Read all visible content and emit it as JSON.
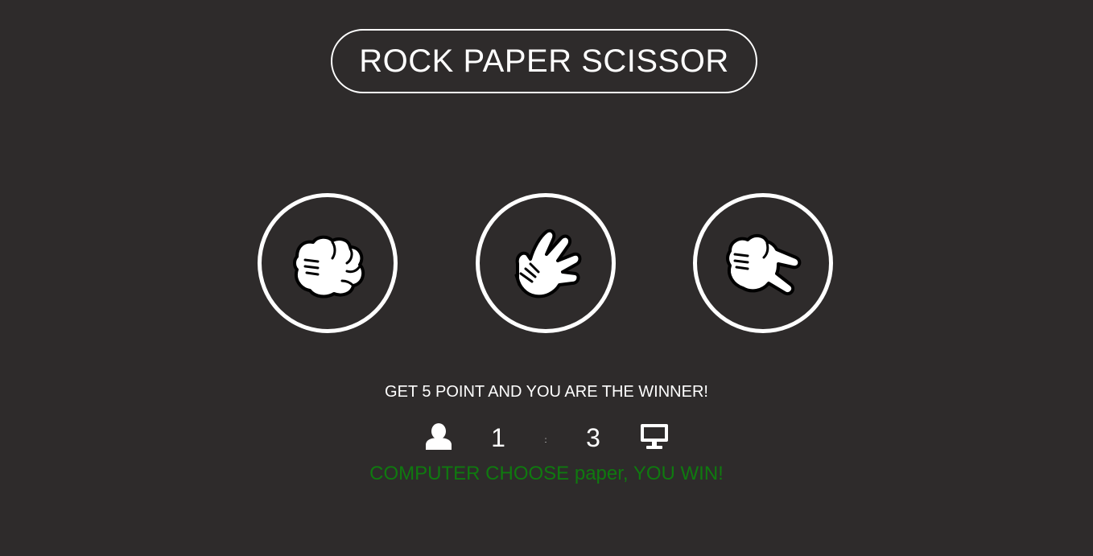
{
  "title": "ROCK PAPER SCISSOR",
  "choices": [
    {
      "id": "rock",
      "icon": "rock-hand-icon"
    },
    {
      "id": "paper",
      "icon": "paper-hand-icon"
    },
    {
      "id": "scissor",
      "icon": "scissor-hand-icon"
    }
  ],
  "hint": "GET 5 POINT AND YOU ARE THE WINNER!",
  "scoreboard": {
    "user_icon": "user-icon",
    "user_score": "1",
    "separator": ":",
    "computer_score": "3",
    "computer_icon": "desktop-icon"
  },
  "result": {
    "message": "COMPUTER CHOOSE paper, YOU WIN!",
    "color": "#0f7a0f"
  },
  "colors": {
    "background": "#2e2b2b",
    "foreground": "#ffffff"
  }
}
